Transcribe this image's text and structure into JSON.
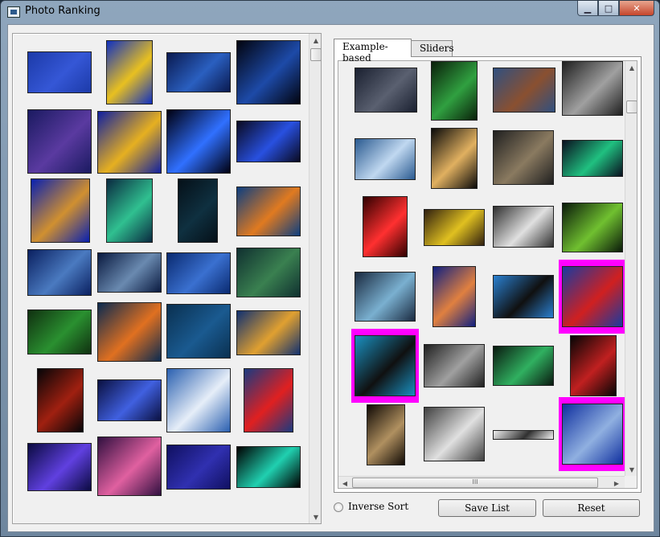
{
  "window": {
    "title": "Photo Ranking"
  },
  "tabs": [
    {
      "label": "Example-based",
      "active": true
    },
    {
      "label": "Sliders",
      "active": false
    }
  ],
  "controls": {
    "inverse_sort_label": "Inverse Sort",
    "save_list_label": "Save List",
    "reset_label": "Reset"
  },
  "scroll": {
    "hscroll_grip": "III"
  },
  "colors": {
    "selection": "#ff00ff",
    "window_bg": "#f0f0f0"
  },
  "left_photos": [
    {
      "name": "photo-water-glass-dots",
      "colors": [
        "#1c3aa8",
        "#3557d6"
      ]
    },
    {
      "name": "photo-pouring-tea-cup",
      "colors": [
        "#1030c0",
        "#e8c020"
      ]
    },
    {
      "name": "photo-city-bridge-night",
      "colors": [
        "#0a1a50",
        "#2a5fc0"
      ]
    },
    {
      "name": "photo-capitol-night-reflection",
      "colors": [
        "#02040f",
        "#1d4aa8"
      ]
    },
    {
      "name": "photo-powerline-sunset-lake",
      "colors": [
        "#1a1a60",
        "#5a3aa0"
      ]
    },
    {
      "name": "photo-golden-glasses",
      "colors": [
        "#1020a0",
        "#e6b020"
      ]
    },
    {
      "name": "photo-gas-flame-ring",
      "colors": [
        "#000010",
        "#3070ff"
      ]
    },
    {
      "name": "photo-blue-flower",
      "colors": [
        "#0a0a20",
        "#2850e0"
      ]
    },
    {
      "name": "photo-cyclist-silhouette",
      "colors": [
        "#0820b0",
        "#d09030"
      ]
    },
    {
      "name": "photo-green-leaf-veins",
      "colors": [
        "#0a2a40",
        "#30c090"
      ]
    },
    {
      "name": "photo-dark-doorway",
      "colors": [
        "#051018",
        "#0f3040"
      ]
    },
    {
      "name": "photo-orange-splash-sea",
      "colors": [
        "#0c3e80",
        "#e07a20"
      ]
    },
    {
      "name": "photo-pier-couple-blue",
      "colors": [
        "#0a2060",
        "#4a7ac0"
      ]
    },
    {
      "name": "photo-lighthouse-dusk",
      "colors": [
        "#0a1a40",
        "#6a8ab0"
      ]
    },
    {
      "name": "photo-swan-blue-lake",
      "colors": [
        "#0a2a70",
        "#3a70d0"
      ]
    },
    {
      "name": "photo-dragonfly-green",
      "colors": [
        "#103030",
        "#3a8050"
      ]
    },
    {
      "name": "photo-green-field-hills",
      "colors": [
        "#103010",
        "#2a9030"
      ]
    },
    {
      "name": "photo-dragonfly-orange-flower",
      "colors": [
        "#0a2a50",
        "#e07020"
      ]
    },
    {
      "name": "photo-blue-surface-abstract",
      "colors": [
        "#0a3050",
        "#1a5a90"
      ]
    },
    {
      "name": "photo-balloon-dragonfly",
      "colors": [
        "#103070",
        "#e0a030"
      ]
    },
    {
      "name": "photo-palm-tree-fire",
      "colors": [
        "#050508",
        "#a02010"
      ]
    },
    {
      "name": "photo-blue-ribbon-swirl",
      "colors": [
        "#0a1040",
        "#4060e0"
      ]
    },
    {
      "name": "photo-sailboat-mast-sky",
      "colors": [
        "#2a60b0",
        "#e6eef8"
      ]
    },
    {
      "name": "photo-red-heart-balloon",
      "colors": [
        "#1a3a80",
        "#e02020"
      ]
    },
    {
      "name": "photo-tangled-cables-purple",
      "colors": [
        "#0a0a40",
        "#6040e0"
      ]
    },
    {
      "name": "photo-pink-sunset-poster",
      "colors": [
        "#301040",
        "#e060a0"
      ]
    },
    {
      "name": "photo-guitar-neck-blue",
      "colors": [
        "#101060",
        "#3030b0"
      ]
    },
    {
      "name": "photo-neon-letters-cyan",
      "colors": [
        "#000000",
        "#20d0b0"
      ]
    }
  ],
  "right_photos": [
    {
      "name": "photo-hand-oil-rainbow",
      "colors": [
        "#1a2030",
        "#5a6070"
      ]
    },
    {
      "name": "photo-green-waterfall",
      "colors": [
        "#0a200a",
        "#30a040"
      ]
    },
    {
      "name": "photo-deer-blue-sky",
      "colors": [
        "#305080",
        "#8a5030"
      ]
    },
    {
      "name": "photo-rocks-monochrome",
      "colors": [
        "#202020",
        "#a0a0a0"
      ]
    },
    {
      "name": "photo-wind-turbines-blue",
      "colors": [
        "#2a5a90",
        "#c0d8f0"
      ]
    },
    {
      "name": "photo-child-reading-dark",
      "colors": [
        "#0a0a0a",
        "#e0b060"
      ]
    },
    {
      "name": "photo-snow-leopard",
      "colors": [
        "#202020",
        "#8a7a60"
      ]
    },
    {
      "name": "photo-aurora-hut",
      "colors": [
        "#0a1020",
        "#20c080"
      ]
    },
    {
      "name": "photo-red-x-lights",
      "colors": [
        "#300000",
        "#ff3030"
      ]
    },
    {
      "name": "photo-yellow-golf-ball",
      "colors": [
        "#302010",
        "#e0c020"
      ]
    },
    {
      "name": "photo-white-feather",
      "colors": [
        "#303030",
        "#e0e0e0"
      ]
    },
    {
      "name": "photo-green-gecko",
      "colors": [
        "#0a1a0a",
        "#70c030"
      ]
    },
    {
      "name": "photo-blue-peacock-bird",
      "colors": [
        "#1a2a40",
        "#7ab0d0"
      ]
    },
    {
      "name": "photo-orange-orchid-blue",
      "colors": [
        "#102080",
        "#e08040"
      ]
    },
    {
      "name": "photo-smoker-silhouette",
      "colors": [
        "#2a80d0",
        "#101010"
      ]
    },
    {
      "name": "photo-red-blue-ribbon",
      "colors": [
        "#1a3aa0",
        "#d02020"
      ],
      "selected": true
    },
    {
      "name": "photo-orca-underwater",
      "colors": [
        "#1a90c0",
        "#101010"
      ],
      "selected": true
    },
    {
      "name": "photo-woman-portrait-bw",
      "colors": [
        "#202020",
        "#a0a0a0"
      ]
    },
    {
      "name": "photo-aurora-green-night",
      "colors": [
        "#0a1a10",
        "#30b060"
      ]
    },
    {
      "name": "photo-red-hand-dark",
      "colors": [
        "#050505",
        "#c02020"
      ]
    },
    {
      "name": "photo-boy-doorway-dark",
      "colors": [
        "#100a05",
        "#b09060"
      ]
    },
    {
      "name": "photo-white-church-bw",
      "colors": [
        "#404040",
        "#e0e0e0"
      ]
    },
    {
      "name": "photo-eyes-closeup",
      "colors": [
        "#f0f0f0",
        "#303030"
      ]
    },
    {
      "name": "photo-mountain-lake-blue",
      "colors": [
        "#1030a0",
        "#90b0e0"
      ],
      "selected": true
    }
  ]
}
